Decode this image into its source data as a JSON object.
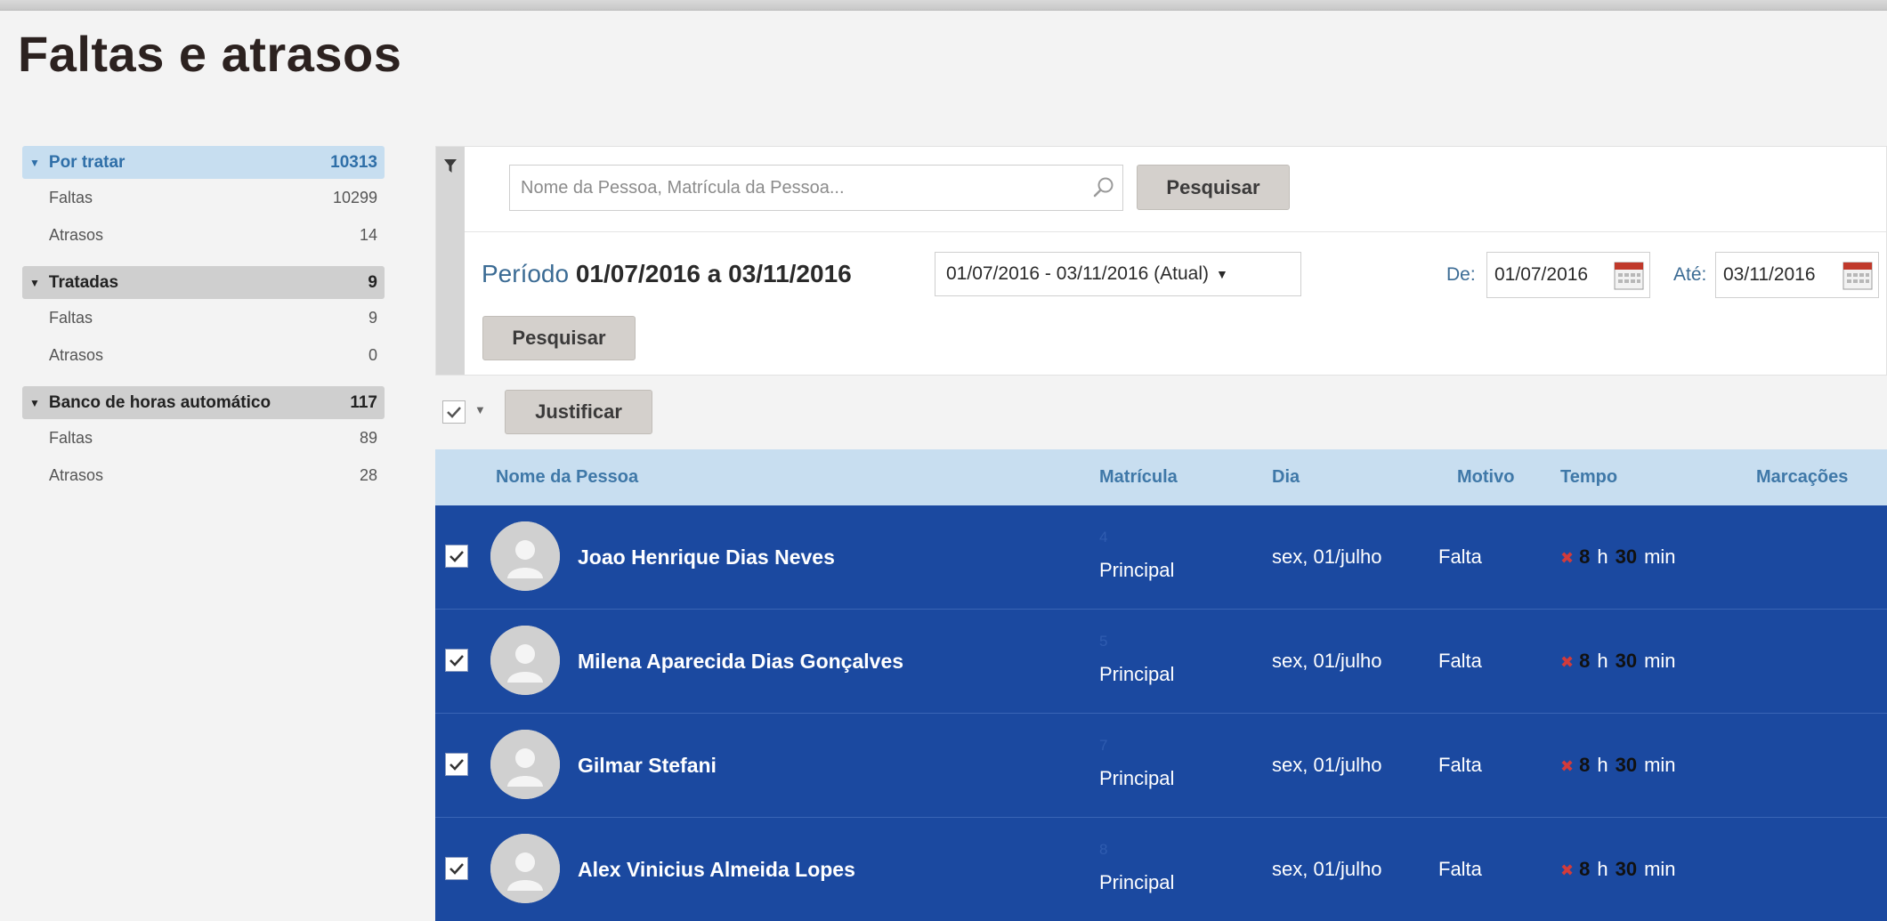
{
  "page": {
    "title": "Faltas e atrasos"
  },
  "sidebar": {
    "groups": [
      {
        "label": "Por tratar",
        "count": "10313",
        "state": "active",
        "items": [
          {
            "label": "Faltas",
            "count": "10299"
          },
          {
            "label": "Atrasos",
            "count": "14"
          }
        ]
      },
      {
        "label": "Tratadas",
        "count": "9",
        "state": "inactive",
        "items": [
          {
            "label": "Faltas",
            "count": "9"
          },
          {
            "label": "Atrasos",
            "count": "0"
          }
        ]
      },
      {
        "label": "Banco de horas automático",
        "count": "117",
        "state": "inactive",
        "items": [
          {
            "label": "Faltas",
            "count": "89"
          },
          {
            "label": "Atrasos",
            "count": "28"
          }
        ]
      }
    ]
  },
  "filters": {
    "search_placeholder": "Nome da Pessoa, Matrícula da Pessoa...",
    "search_button": "Pesquisar",
    "periodo_label": "Período",
    "periodo_dates": "01/07/2016 a 03/11/2016",
    "period_select": "01/07/2016 - 03/11/2016 (Atual)",
    "de_label": "De:",
    "de_value": "01/07/2016",
    "ate_label": "Até:",
    "ate_value": "03/11/2016",
    "pesquisar_button": "Pesquisar"
  },
  "bulk": {
    "justify_button": "Justificar"
  },
  "table": {
    "headers": {
      "nome": "Nome da Pessoa",
      "matricula": "Matrícula",
      "dia": "Dia",
      "motivo": "Motivo",
      "tempo": "Tempo",
      "marcacoes": "Marcações"
    },
    "rows": [
      {
        "name": "Joao Henrique Dias Neves",
        "matricula_num": "4",
        "matricula_tipo": "Principal",
        "dia": "sex, 01/julho",
        "motivo": "Falta",
        "horas": "8",
        "h": "h",
        "minutos": "30",
        "min": "min"
      },
      {
        "name": "Milena Aparecida Dias Gonçalves",
        "matricula_num": "5",
        "matricula_tipo": "Principal",
        "dia": "sex, 01/julho",
        "motivo": "Falta",
        "horas": "8",
        "h": "h",
        "minutos": "30",
        "min": "min"
      },
      {
        "name": "Gilmar Stefani",
        "matricula_num": "7",
        "matricula_tipo": "Principal",
        "dia": "sex, 01/julho",
        "motivo": "Falta",
        "horas": "8",
        "h": "h",
        "minutos": "30",
        "min": "min"
      },
      {
        "name": "Alex Vinicius Almeida Lopes",
        "matricula_num": "8",
        "matricula_tipo": "Principal",
        "dia": "sex, 01/julho",
        "motivo": "Falta",
        "horas": "8",
        "h": "h",
        "minutos": "30",
        "min": "min"
      }
    ]
  }
}
